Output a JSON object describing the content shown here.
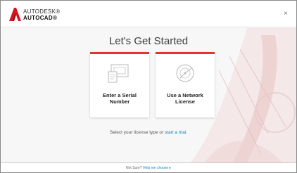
{
  "header": {
    "brand_top": "AUTODESK®",
    "brand_bottom": "AUTOCAD®",
    "close_glyph": "×"
  },
  "main": {
    "title": "Let's Get Started",
    "cards": [
      {
        "label": "Enter a Serial\nNumber",
        "icon": "serial-number-icon"
      },
      {
        "label": "Use a Network\nLicense",
        "icon": "network-license-icon"
      }
    ],
    "select_prefix": "Select your license type or",
    "start_trial_link": "start a trial."
  },
  "footer": {
    "prefix": "Not Sure?",
    "help_link": "Help me choose ▸"
  },
  "colors": {
    "accent_red": "#e0352b",
    "link_blue": "#1a7fc1"
  }
}
